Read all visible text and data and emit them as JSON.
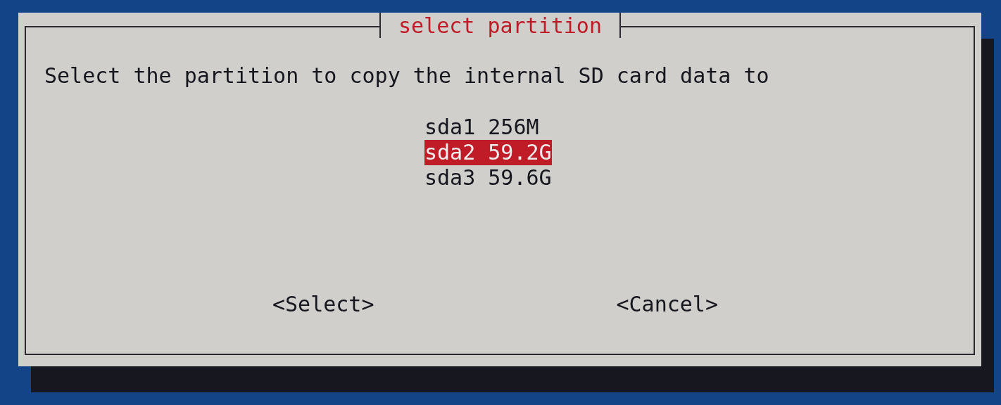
{
  "dialog": {
    "title": "select partition",
    "message": "Select the partition to copy the internal SD card data to",
    "partitions": [
      {
        "label": "sda1 256M",
        "selected": false
      },
      {
        "label": "sda2 59.2G",
        "selected": true
      },
      {
        "label": "sda3 59.6G",
        "selected": false
      }
    ],
    "buttons": [
      {
        "label": "<Select>"
      },
      {
        "label": "<Cancel>"
      }
    ]
  }
}
